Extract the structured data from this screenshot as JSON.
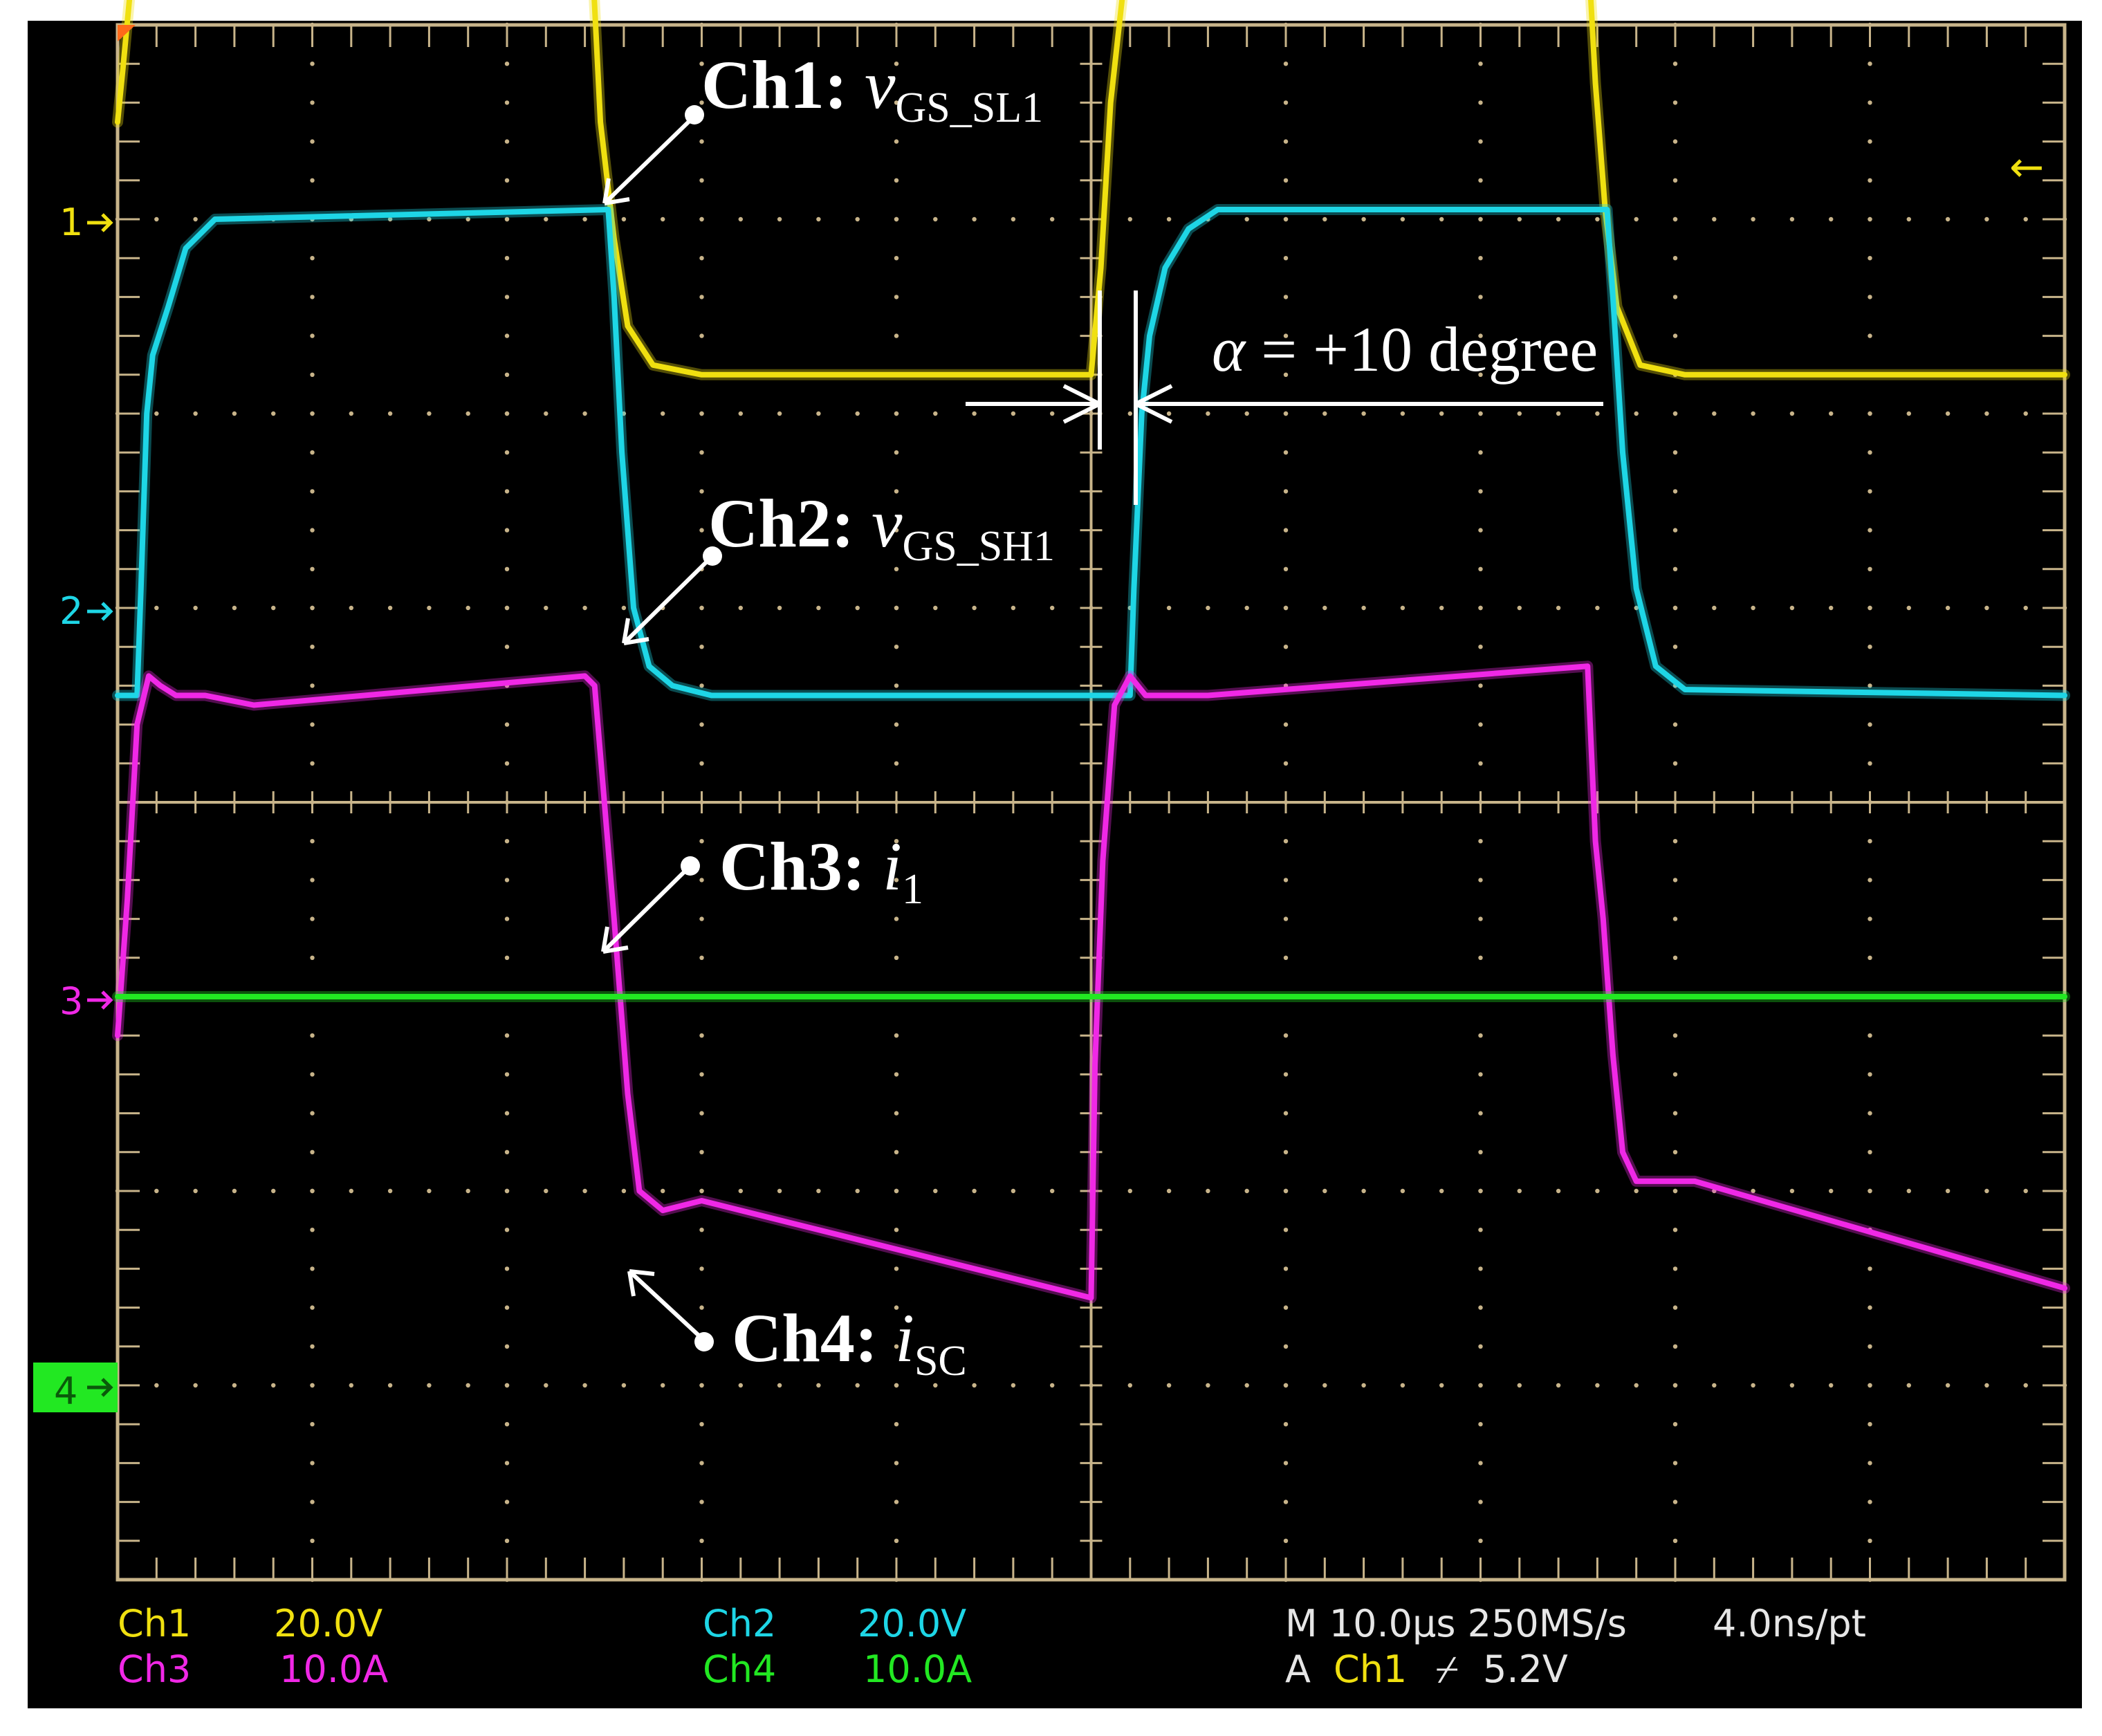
{
  "colors": {
    "ch1": "#f0e010",
    "ch2": "#1ed6e6",
    "ch3": "#f028e6",
    "ch4": "#22e822",
    "grid": "#c8b48a",
    "background": "#000000",
    "annotation": "#ffffff",
    "orange_marker": "#ff6a1a"
  },
  "chart_data": {
    "type": "line",
    "x_units": "µs",
    "grid": true,
    "divisions": {
      "x": 10,
      "y": 8
    },
    "xlim": [
      0,
      100
    ],
    "ylim_divisions": [
      -4,
      4
    ],
    "series": [
      {
        "name": "Ch1",
        "channel": 1,
        "color": "#f0e010",
        "offset_div": 3,
        "x": [
          0,
          0.3,
          1.0,
          2.0,
          4.0,
          23.8,
          24.2,
          24.8,
          25.5,
          26.2,
          27.5,
          30.0,
          50.0,
          50.5,
          51.0,
          52.0,
          53.5,
          55.5,
          75.0,
          75.3,
          75.9,
          76.4,
          77.0,
          78.2,
          80.5,
          100
        ],
        "y": [
          0.5,
          0.8,
          1.55,
          2.0,
          2.2,
          2.2,
          1.7,
          0.5,
          -0.1,
          -0.55,
          -0.75,
          -0.8,
          -0.8,
          -0.25,
          0.6,
          1.5,
          2.0,
          2.2,
          2.2,
          1.8,
          0.7,
          0.05,
          -0.45,
          -0.75,
          -0.8,
          -0.8
        ]
      },
      {
        "name": "Ch2",
        "channel": 2,
        "color": "#1ed6e6",
        "offset_div": 1,
        "x": [
          0,
          1.0,
          1.2,
          1.5,
          1.8,
          2.6,
          3.5,
          5.0,
          25.2,
          25.5,
          25.9,
          26.5,
          27.3,
          28.5,
          30.5,
          52.0,
          52.2,
          52.6,
          53.0,
          53.8,
          55.0,
          56.5,
          76.5,
          76.8,
          77.3,
          78.0,
          79.0,
          80.5,
          100
        ],
        "y": [
          -0.45,
          -0.45,
          0.1,
          1.0,
          1.3,
          1.55,
          1.85,
          2.0,
          2.05,
          1.6,
          0.8,
          0.0,
          -0.3,
          -0.4,
          -0.45,
          -0.45,
          0.1,
          1.0,
          1.4,
          1.75,
          1.95,
          2.05,
          2.05,
          1.6,
          0.8,
          0.1,
          -0.3,
          -0.42,
          -0.45
        ]
      },
      {
        "name": "Ch3",
        "channel": 3,
        "color": "#f028e6",
        "offset_div": -1,
        "x": [
          0,
          0.5,
          1.0,
          1.6,
          2.2,
          3.0,
          4.5,
          7.0,
          24.0,
          24.5,
          25.0,
          25.5,
          26.2,
          26.8,
          28.0,
          30.0,
          50.0,
          50.2,
          50.6,
          51.2,
          52.0,
          52.8,
          54.0,
          56.0,
          75.5,
          75.9,
          76.3,
          76.8,
          77.3,
          78.0,
          79.0,
          81.0,
          100
        ],
        "y": [
          -0.2,
          0.5,
          1.4,
          1.65,
          1.6,
          1.55,
          1.55,
          1.5,
          1.65,
          1.6,
          1.0,
          0.4,
          -0.5,
          -1.0,
          -1.1,
          -1.05,
          -1.55,
          -0.35,
          0.7,
          1.5,
          1.65,
          1.55,
          1.55,
          1.55,
          1.7,
          0.8,
          0.4,
          -0.3,
          -0.8,
          -0.95,
          -0.95,
          -0.95,
          -1.5
        ]
      },
      {
        "name": "Ch4",
        "channel": 4,
        "color": "#22e822",
        "offset_div": -3,
        "x": [
          0,
          100
        ],
        "y": [
          2.0,
          2.0
        ]
      }
    ]
  },
  "channel_markers": [
    {
      "label": "1",
      "channel": 1
    },
    {
      "label": "2",
      "channel": 2
    },
    {
      "label": "3",
      "channel": 3
    },
    {
      "label": "4",
      "channel": 4
    }
  ],
  "annotations": {
    "ch1": {
      "label": "Ch1:",
      "var": "v",
      "sub": "GS_SL1"
    },
    "ch2": {
      "label": "Ch2:",
      "var": "v",
      "sub": "GS_SH1"
    },
    "ch3": {
      "label": "Ch3:",
      "var": "i",
      "sub": "1"
    },
    "ch4": {
      "label": "Ch4:",
      "var": "i",
      "sub": "SC"
    },
    "alpha": {
      "symbol": "α",
      "rest": " = +10 degree"
    }
  },
  "readout": {
    "ch1_name": "Ch1",
    "ch1_scale": "20.0V",
    "ch3_name": "Ch3",
    "ch3_scale": "10.0A",
    "ch2_name": "Ch2",
    "ch2_scale": "20.0V",
    "ch4_name": "Ch4",
    "ch4_scale": "10.0A",
    "timebase": "M 10.0µs 250MS/s",
    "resolution": "4.0ns/pt",
    "trigger_prefix": "A",
    "trigger_source": "Ch1",
    "trigger_slope": "⌿",
    "trigger_level": "5.2V"
  },
  "right_marker": "←"
}
